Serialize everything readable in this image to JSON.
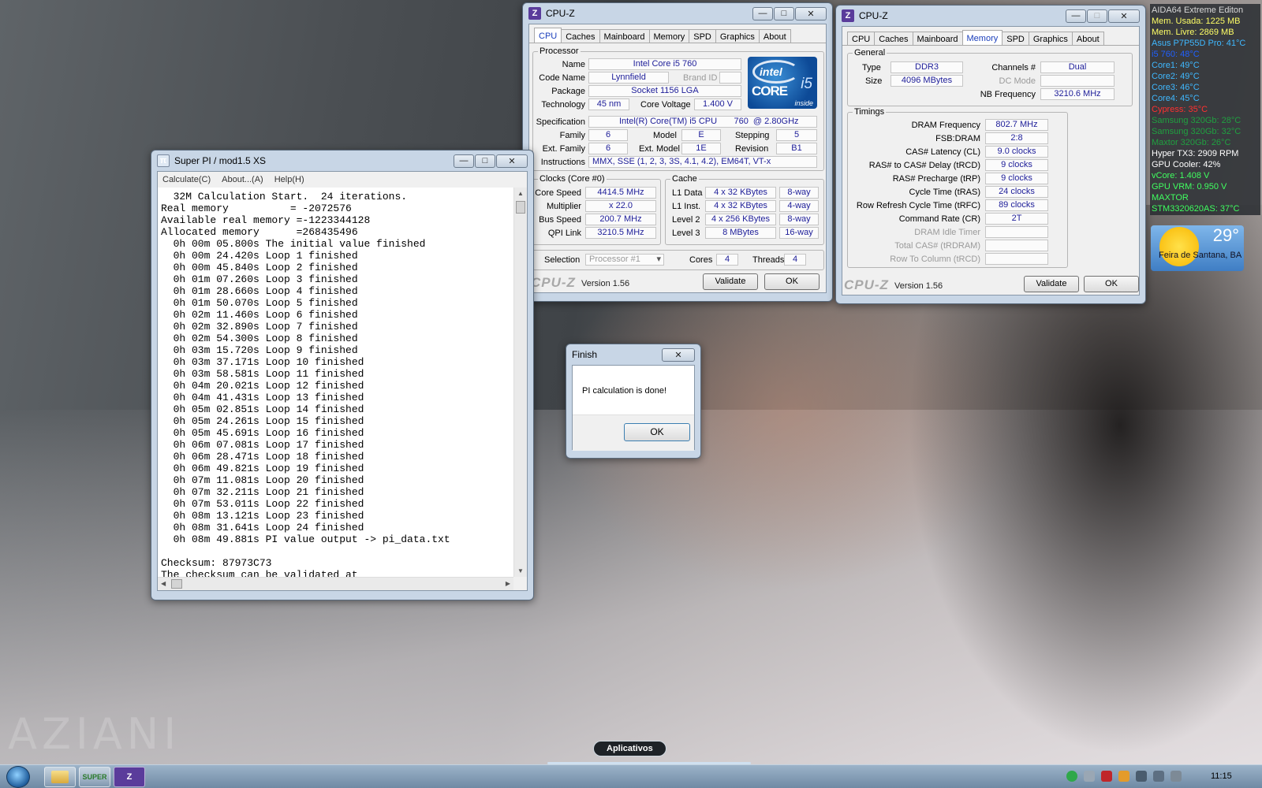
{
  "desktop": {
    "watermark": "AZIANI"
  },
  "cpuz_cpu": {
    "title": "CPU-Z",
    "tabs": [
      "CPU",
      "Caches",
      "Mainboard",
      "Memory",
      "SPD",
      "Graphics",
      "About"
    ],
    "active_tab": "CPU",
    "processor_label": "Processor",
    "name_label": "Name",
    "name": "Intel Core i5 760",
    "codename_label": "Code Name",
    "codename": "Lynnfield",
    "brandid_label": "Brand ID",
    "package_label": "Package",
    "package": "Socket 1156 LGA",
    "technology_label": "Technology",
    "technology": "45 nm",
    "corevoltage_label": "Core Voltage",
    "corevoltage": "1.400 V",
    "spec_label": "Specification",
    "spec": "Intel(R) Core(TM) i5 CPU       760  @ 2.80GHz",
    "family_label": "Family",
    "family": "6",
    "model_label": "Model",
    "model": "E",
    "stepping_label": "Stepping",
    "stepping": "5",
    "extfamily_label": "Ext. Family",
    "extfamily": "6",
    "extmodel_label": "Ext. Model",
    "extmodel": "1E",
    "revision_label": "Revision",
    "revision": "B1",
    "instructions_label": "Instructions",
    "instructions": "MMX, SSE (1, 2, 3, 3S, 4.1, 4.2), EM64T, VT-x",
    "clocks_label": "Clocks (Core #0)",
    "corespeed_label": "Core Speed",
    "corespeed": "4414.5 MHz",
    "multiplier_label": "Multiplier",
    "multiplier": "x 22.0",
    "busspeed_label": "Bus Speed",
    "busspeed": "200.7 MHz",
    "qpilink_label": "QPI Link",
    "qpilink": "3210.5 MHz",
    "cache_label": "Cache",
    "l1data_label": "L1 Data",
    "l1data": "4 x 32 KBytes",
    "l1data_way": "8-way",
    "l1inst_label": "L1 Inst.",
    "l1inst": "4 x 32 KBytes",
    "l1inst_way": "4-way",
    "level2_label": "Level 2",
    "level2": "4 x 256 KBytes",
    "level2_way": "8-way",
    "level3_label": "Level 3",
    "level3": "8 MBytes",
    "level3_way": "16-way",
    "selection_label": "Selection",
    "selection": "Processor #1",
    "cores_label": "Cores",
    "cores": "4",
    "threads_label": "Threads",
    "threads": "4",
    "logo": "CPU-Z",
    "version": "Version 1.56",
    "validate": "Validate",
    "ok": "OK",
    "intel_logo": {
      "brand": "intel",
      "line": "CORE",
      "model": "i5",
      "inside": "inside"
    }
  },
  "cpuz_mem": {
    "title": "CPU-Z",
    "tabs": [
      "CPU",
      "Caches",
      "Mainboard",
      "Memory",
      "SPD",
      "Graphics",
      "About"
    ],
    "active_tab": "Memory",
    "general_label": "General",
    "type_label": "Type",
    "type": "DDR3",
    "size_label": "Size",
    "size": "4096 MBytes",
    "channels_label": "Channels #",
    "channels": "Dual",
    "dcmode_label": "DC Mode",
    "nbfreq_label": "NB Frequency",
    "nbfreq": "3210.6 MHz",
    "timings_label": "Timings",
    "dramfreq_label": "DRAM Frequency",
    "dramfreq": "802.7 MHz",
    "fsbdram_label": "FSB:DRAM",
    "fsbdram": "2:8",
    "cl_label": "CAS# Latency (CL)",
    "cl": "9.0 clocks",
    "trcd_label": "RAS# to CAS# Delay (tRCD)",
    "trcd": "9 clocks",
    "trp_label": "RAS# Precharge (tRP)",
    "trp": "9 clocks",
    "tras_label": "Cycle Time (tRAS)",
    "tras": "24 clocks",
    "trfc_label": "Row Refresh Cycle Time (tRFC)",
    "trfc": "89 clocks",
    "cr_label": "Command Rate (CR)",
    "cr": "2T",
    "idle_label": "DRAM Idle Timer",
    "trdram_label": "Total CAS# (tRDRAM)",
    "trcd2_label": "Row To Column (tRCD)",
    "logo": "CPU-Z",
    "version": "Version 1.56",
    "validate": "Validate",
    "ok": "OK"
  },
  "superpi": {
    "title": "Super PI / mod1.5 XS",
    "menu": [
      "Calculate(C)",
      "About...(A)",
      "Help(H)"
    ],
    "lines": [
      "  32M Calculation Start.  24 iterations.",
      "Real memory          = -2072576",
      "Available real memory =-1223344128",
      "Allocated memory      =268435496",
      "  0h 00m 05.800s The initial value finished",
      "  0h 00m 24.420s Loop 1 finished",
      "  0h 00m 45.840s Loop 2 finished",
      "  0h 01m 07.260s Loop 3 finished",
      "  0h 01m 28.660s Loop 4 finished",
      "  0h 01m 50.070s Loop 5 finished",
      "  0h 02m 11.460s Loop 6 finished",
      "  0h 02m 32.890s Loop 7 finished",
      "  0h 02m 54.300s Loop 8 finished",
      "  0h 03m 15.720s Loop 9 finished",
      "  0h 03m 37.171s Loop 10 finished",
      "  0h 03m 58.581s Loop 11 finished",
      "  0h 04m 20.021s Loop 12 finished",
      "  0h 04m 41.431s Loop 13 finished",
      "  0h 05m 02.851s Loop 14 finished",
      "  0h 05m 24.261s Loop 15 finished",
      "  0h 05m 45.691s Loop 16 finished",
      "  0h 06m 07.081s Loop 17 finished",
      "  0h 06m 28.471s Loop 18 finished",
      "  0h 06m 49.821s Loop 19 finished",
      "  0h 07m 11.081s Loop 20 finished",
      "  0h 07m 32.211s Loop 21 finished",
      "  0h 07m 53.011s Loop 22 finished",
      "  0h 08m 13.121s Loop 23 finished",
      "  0h 08m 31.641s Loop 24 finished",
      "  0h 08m 49.881s PI value output -> pi_data.txt",
      "",
      "Checksum: 87973C73",
      "The checksum can be validated at"
    ]
  },
  "finish_dialog": {
    "title": "Finish",
    "message": "PI calculation is done!",
    "ok": "OK"
  },
  "aida": {
    "lines": [
      {
        "text": "AIDA64 Extreme Editon",
        "color": "#d8d8d8"
      },
      {
        "text": "Mem. Usada: 1225 MB",
        "color": "#ffff66"
      },
      {
        "text": "Mem. Livre: 2869 MB",
        "color": "#ffff66"
      },
      {
        "text": "Asus P7P55D Pro: 41°C",
        "color": "#3fb8ff"
      },
      {
        "text": "i5 760: 48°C",
        "color": "#2060ff"
      },
      {
        "text": "Core1: 49°C",
        "color": "#3fb8ff"
      },
      {
        "text": "Core2: 49°C",
        "color": "#3fb8ff"
      },
      {
        "text": "Core3: 46°C",
        "color": "#3fb8ff"
      },
      {
        "text": "Core4: 45°C",
        "color": "#3fb8ff"
      },
      {
        "text": "Cypress: 35°C",
        "color": "#ff3030"
      },
      {
        "text": "Samsung 320Gb: 28°C",
        "color": "#20a040"
      },
      {
        "text": "Samsung 320Gb: 32°C",
        "color": "#20a040"
      },
      {
        "text": "Maxtor 320Gb: 26°C",
        "color": "#20a040"
      },
      {
        "text": "Hyper TX3: 2909 RPM",
        "color": "#ffffff"
      },
      {
        "text": "GPU Cooler: 42%",
        "color": "#ffffff"
      },
      {
        "text": "vCore: 1.408 V",
        "color": "#40ff60"
      },
      {
        "text": "GPU VRM: 0.950 V",
        "color": "#40ff60"
      },
      {
        "text": "MAXTOR",
        "color": "#40ff60"
      },
      {
        "text": "STM3320620AS: 37°C",
        "color": "#40ff60"
      }
    ]
  },
  "weather": {
    "temp": "29°",
    "city": "Feira de Santana, BA"
  },
  "taskbar": {
    "tooltip": "Aplicativos",
    "superpi_label": "SUPER",
    "cpuz_label": "Z",
    "clock": "11:15"
  }
}
